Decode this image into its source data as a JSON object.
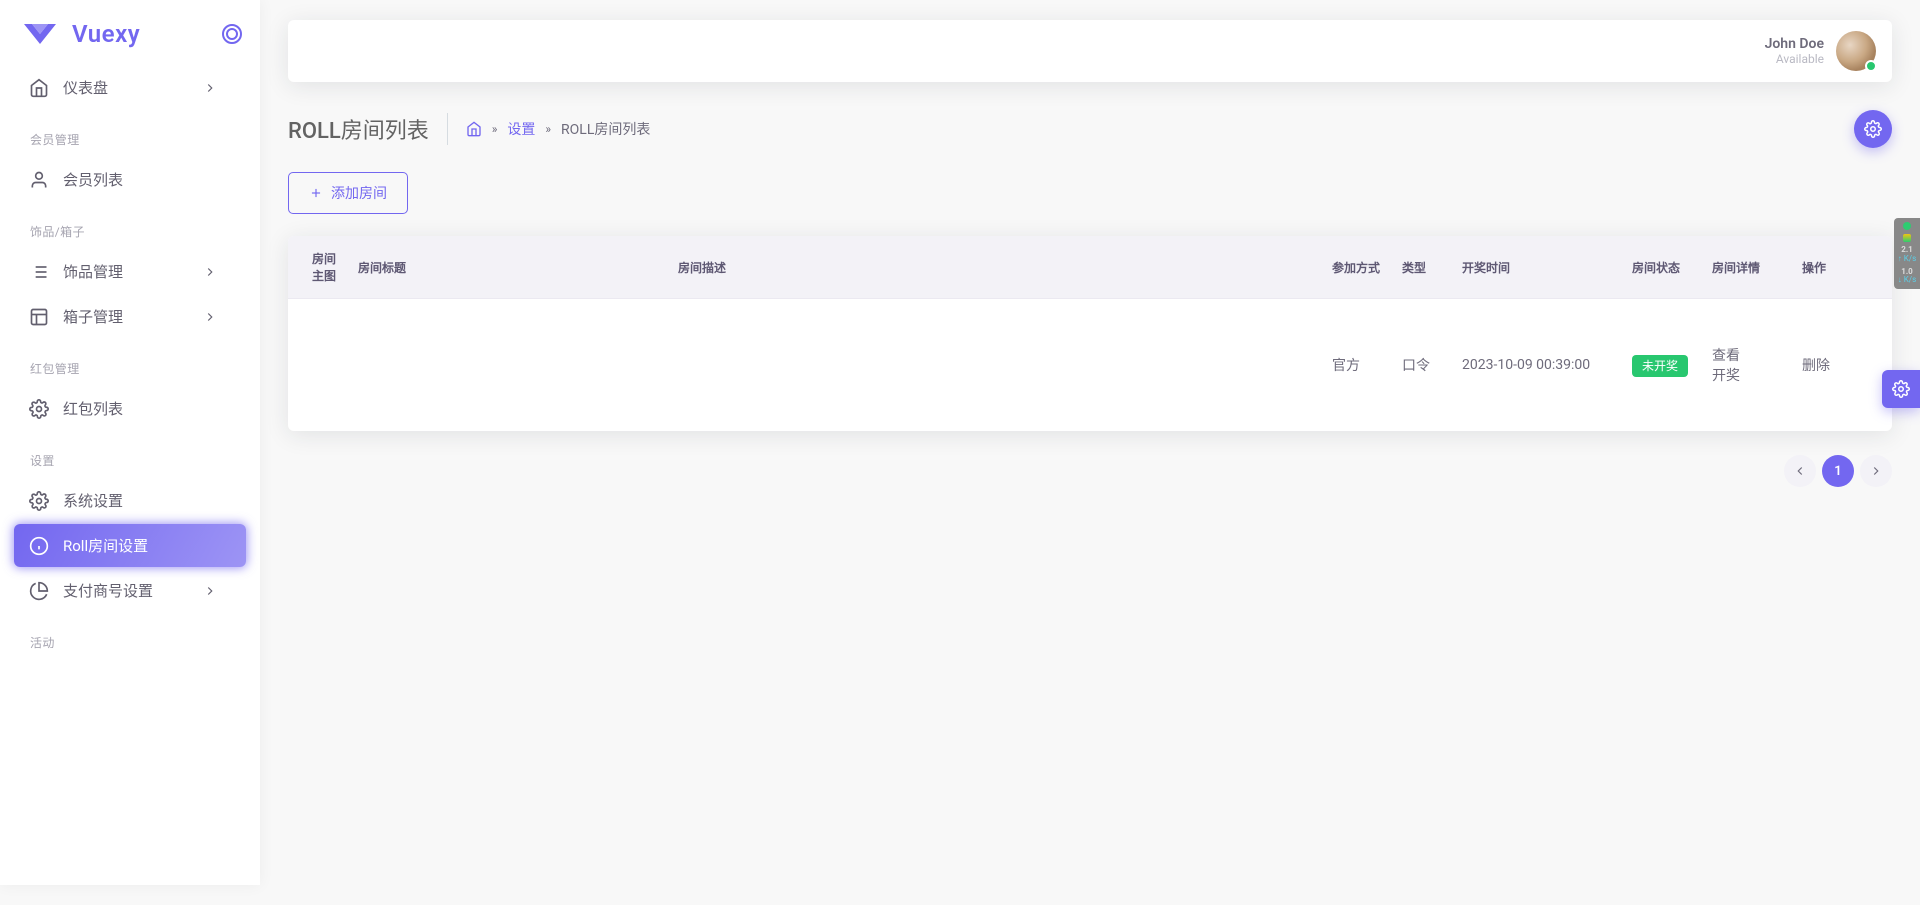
{
  "brand": {
    "name": "Vuexy"
  },
  "user": {
    "name": "John Doe",
    "status": "Available"
  },
  "sidebar": {
    "items": {
      "dashboard": "仪表盘",
      "members": "会员列表",
      "accessory": "饰品管理",
      "box": "箱子管理",
      "redpacket": "红包列表",
      "system": "系统设置",
      "roll": "Roll房间设置",
      "payment": "支付商号设置"
    },
    "headers": {
      "member": "会员管理",
      "goods": "饰品/箱子",
      "red": "红包管理",
      "settings": "设置",
      "activity": "活动"
    }
  },
  "page": {
    "title": "ROLL房间列表",
    "breadcrumb": {
      "settings": "设置",
      "current": "ROLL房间列表"
    }
  },
  "actions": {
    "add": "添加房间"
  },
  "table": {
    "headers": {
      "image": "房间主图",
      "title": "房间标题",
      "desc": "房间描述",
      "join": "参加方式",
      "type": "类型",
      "open": "开奖时间",
      "state": "房间状态",
      "detail": "房间详情",
      "ops": "操作"
    },
    "rows": [
      {
        "image": "",
        "title": "",
        "desc": "",
        "join": "官方",
        "type": "口令",
        "open": "2023-10-09 00:39:00",
        "state": "未开奖",
        "actions": {
          "view": "查看",
          "draw": "开奖",
          "delete": "删除"
        }
      }
    ]
  },
  "pagination": {
    "current": "1"
  },
  "perf": {
    "up": "2.1",
    "upu": "K/s",
    "down": "1.0",
    "downu": "K/s"
  }
}
